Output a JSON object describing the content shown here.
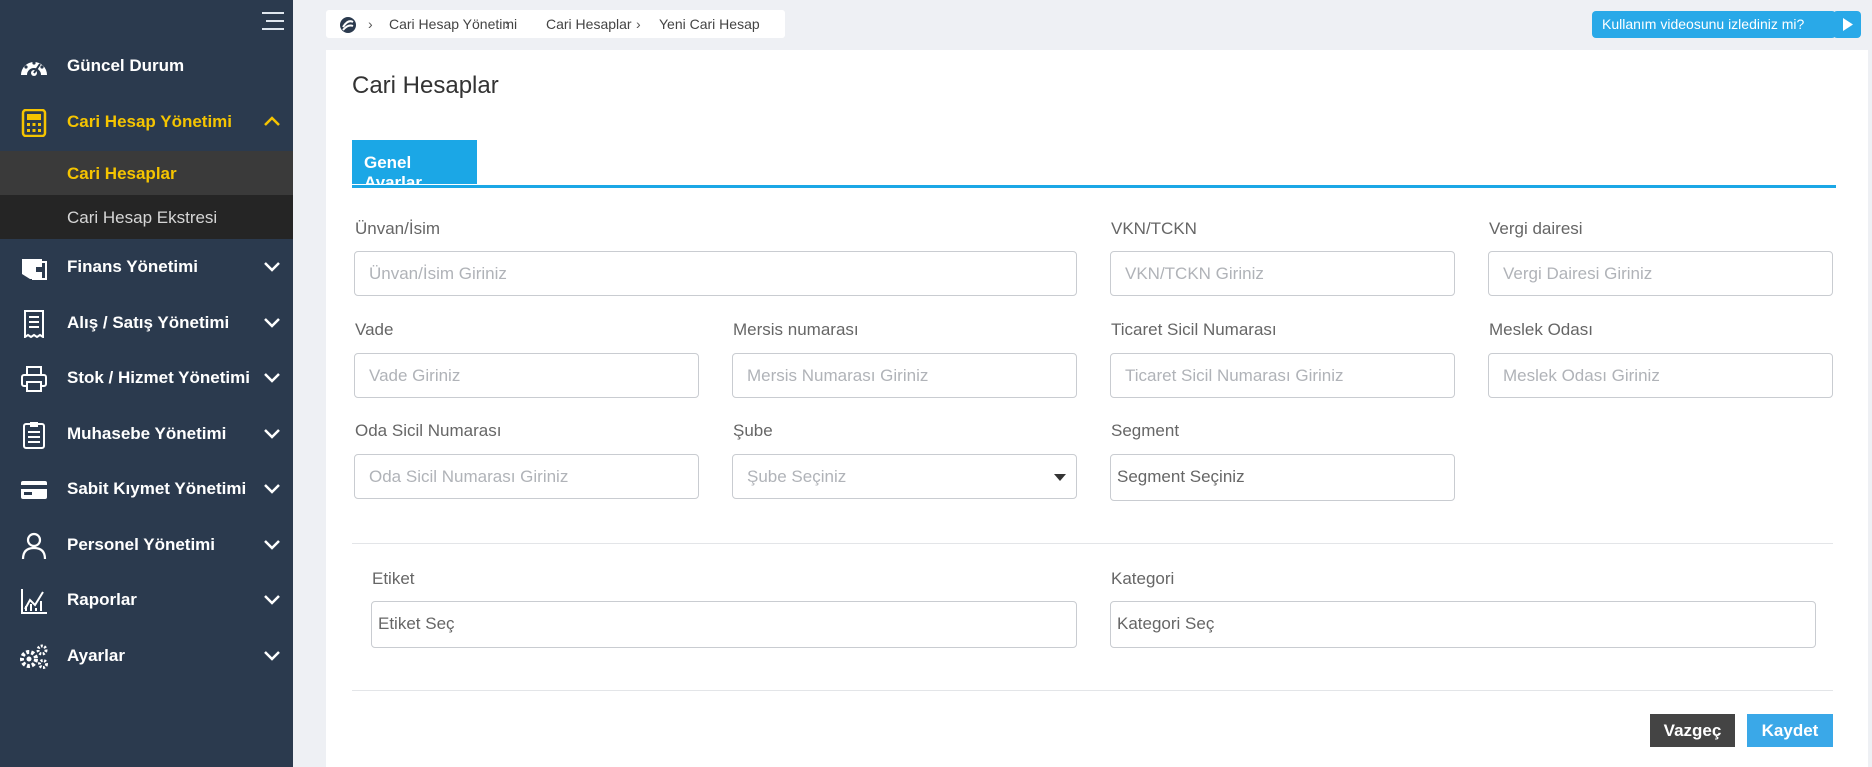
{
  "sidebar": {
    "items": [
      {
        "label": "Güncel Durum",
        "icon": "dashboard-icon"
      },
      {
        "label": "Cari Hesap Yönetimi",
        "icon": "calculator-icon",
        "active": true
      },
      {
        "label": "Finans Yönetimi",
        "icon": "wallet-icon"
      },
      {
        "label": "Alış / Satış Yönetimi",
        "icon": "receipt-icon"
      },
      {
        "label": "Stok / Hizmet Yönetimi",
        "icon": "printer-icon"
      },
      {
        "label": "Muhasebe Yönetimi",
        "icon": "clipboard-icon"
      },
      {
        "label": "Sabit Kıymet Yönetimi",
        "icon": "credit-card-icon"
      },
      {
        "label": "Personel Yönetimi",
        "icon": "user-icon"
      },
      {
        "label": "Raporlar",
        "icon": "chart-icon"
      },
      {
        "label": "Ayarlar",
        "icon": "gears-icon"
      }
    ],
    "subitems": [
      {
        "label": "Cari Hesaplar",
        "current": true
      },
      {
        "label": "Cari Hesap Ekstresi"
      }
    ]
  },
  "breadcrumb": [
    "Cari Hesap Yönetimi",
    "Cari Hesaplar",
    "Yeni Cari Hesap"
  ],
  "video_button": "Kullanım videosunu izlediniz mi?",
  "page_title": "Cari Hesaplar",
  "tab": "Genel Ayarlar",
  "form": {
    "unvan": {
      "label": "Ünvan/İsim",
      "placeholder": "Ünvan/İsim Giriniz"
    },
    "vkn": {
      "label": "VKN/TCKN",
      "placeholder": "VKN/TCKN Giriniz"
    },
    "vergi": {
      "label": "Vergi dairesi",
      "placeholder": "Vergi Dairesi Giriniz"
    },
    "vade": {
      "label": "Vade",
      "placeholder": "Vade Giriniz"
    },
    "mersis": {
      "label": "Mersis numarası",
      "placeholder": "Mersis Numarası Giriniz"
    },
    "ticaret": {
      "label": "Ticaret Sicil Numarası",
      "placeholder": "Ticaret Sicil Numarası Giriniz"
    },
    "meslek": {
      "label": "Meslek Odası",
      "placeholder": "Meslek Odası Giriniz"
    },
    "oda": {
      "label": "Oda Sicil Numarası",
      "placeholder": "Oda Sicil Numarası Giriniz"
    },
    "sube": {
      "label": "Şube",
      "value": "Şube Seçiniz"
    },
    "segment": {
      "label": "Segment",
      "value": "Segment Seçiniz"
    },
    "etiket": {
      "label": "Etiket",
      "value": "Etiket Seç"
    },
    "kategori": {
      "label": "Kategori",
      "value": "Kategori Seç"
    }
  },
  "buttons": {
    "cancel": "Vazgeç",
    "save": "Kaydet"
  },
  "colors": {
    "sidebar": "#2b3a4e",
    "accent": "#1ba7e6",
    "active_text": "#f5c400"
  }
}
